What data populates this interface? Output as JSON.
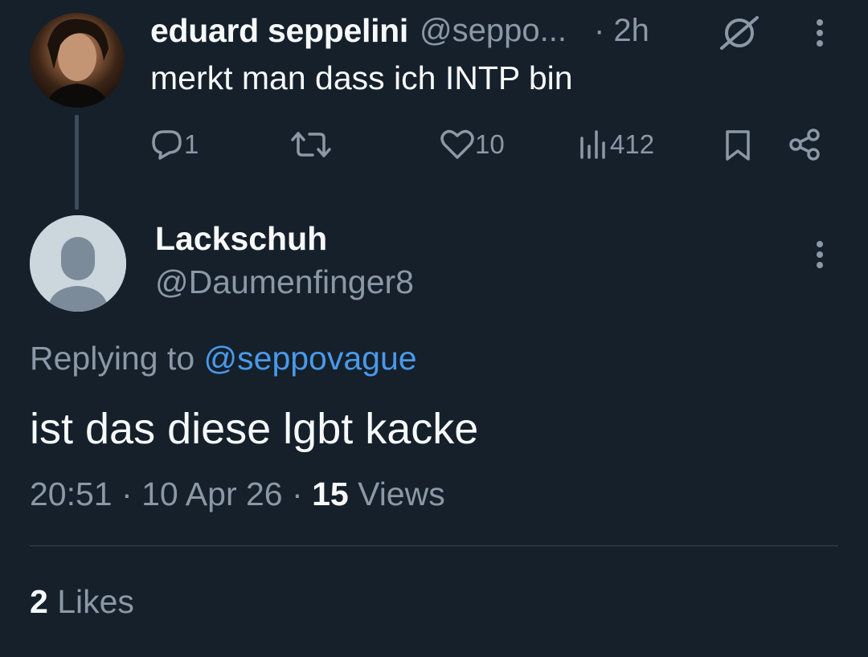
{
  "original_tweet": {
    "author_name": "eduard seppelini",
    "author_handle": "@seppo...",
    "time": "· 2h",
    "text": "merkt man dass ich INTP bin",
    "actions": {
      "reply_count": "1",
      "retweet_count": "",
      "like_count": "10",
      "view_count": "412"
    },
    "icons": [
      "grok-icon",
      "more-icon",
      "reply-icon",
      "retweet-icon",
      "like-icon",
      "views-icon",
      "bookmark-icon",
      "share-icon"
    ]
  },
  "reply": {
    "author_name": "Lackschuh",
    "author_handle": "@Daumenfinger8",
    "replying_prefix": "Replying to",
    "replying_mention": "@seppovague",
    "text": "ist das diese lgbt kacke",
    "time": "20:51",
    "sep1": "·",
    "date": "10 Apr 26",
    "sep2": "·",
    "views_count": "15",
    "views_label": "Views",
    "likes_count": "2",
    "likes_label": "Likes"
  },
  "colors": {
    "background": "#15202b",
    "text_primary": "#f7f9f9",
    "text_secondary": "#8b98a5",
    "link": "#4a99e9",
    "divider": "#38444d"
  }
}
